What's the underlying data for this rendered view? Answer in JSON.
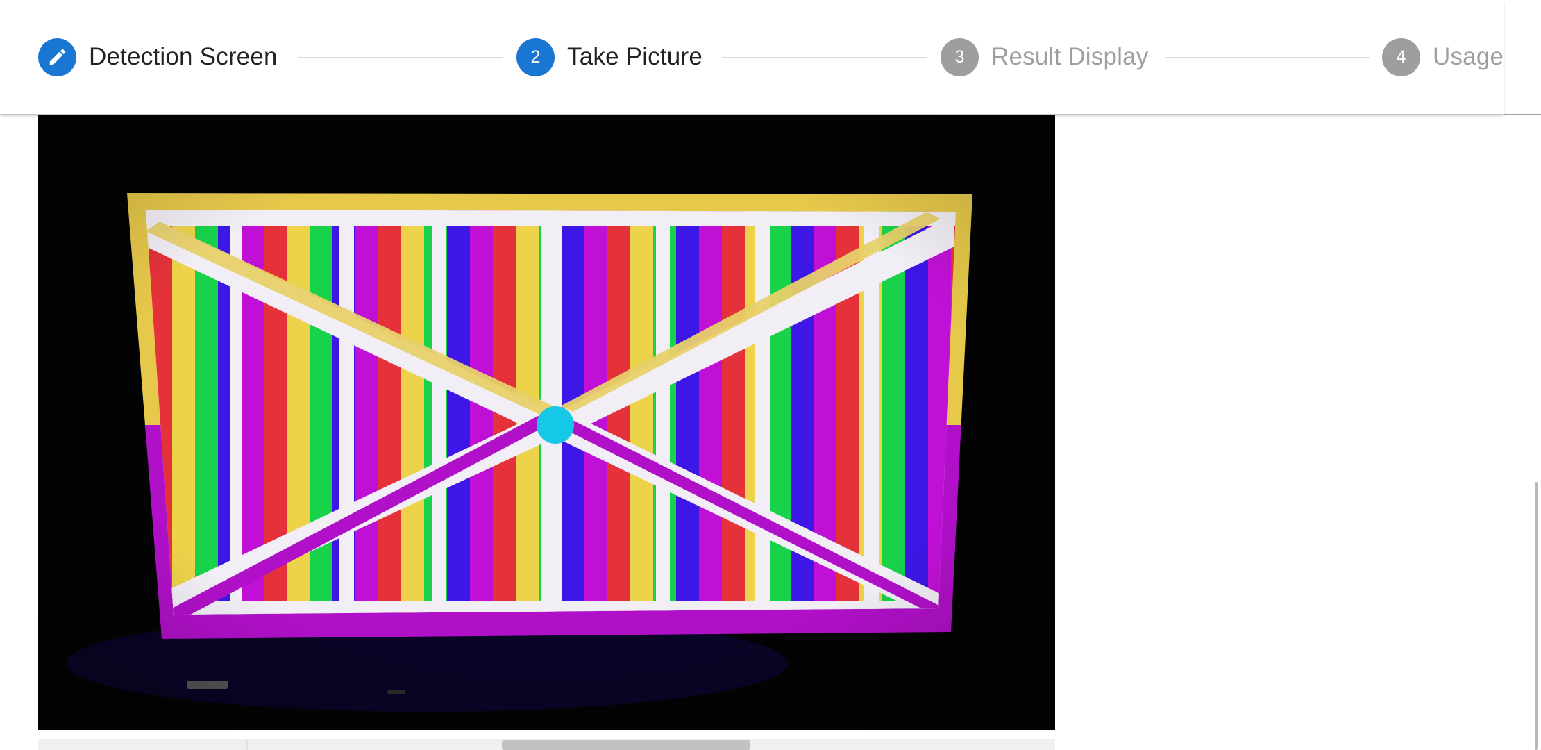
{
  "colors": {
    "active": "#1976d2",
    "inactive": "#9e9e9e",
    "text_active": "#212121",
    "text_inactive": "#9e9e9e",
    "stripes": [
      "#e5323a",
      "#ecd34a",
      "#18d24a",
      "#3c17e6",
      "#c010d6"
    ],
    "frame_top": "#e6c84a",
    "frame_bottom": "#b010c8",
    "center_dot": "#14c8e6"
  },
  "stepper": {
    "steps": [
      {
        "number": "",
        "icon": "pencil-icon",
        "label": "Detection Screen",
        "state": "completed"
      },
      {
        "number": "2",
        "label": "Take Picture",
        "state": "active"
      },
      {
        "number": "3",
        "label": "Result Display",
        "state": "inactive"
      },
      {
        "number": "4",
        "label": "Usage",
        "state": "inactive"
      }
    ]
  },
  "camera": {
    "content": "test-pattern-photo"
  }
}
